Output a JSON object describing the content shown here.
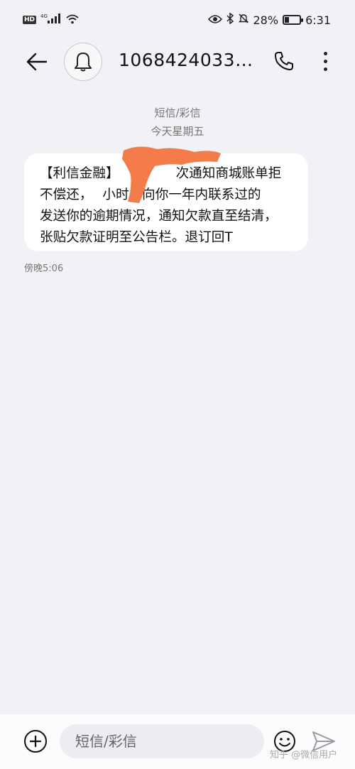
{
  "status_bar": {
    "hd_label": "HD",
    "network_label": "4G",
    "battery_percent": "28%",
    "battery_level": 0.28,
    "time": "6:31",
    "icons": [
      "signal-icon",
      "wifi-icon",
      "eye-icon",
      "bluetooth-icon",
      "mute-icon",
      "battery-icon"
    ]
  },
  "header": {
    "back_icon": "arrow-left-icon",
    "avatar_icon": "bell-icon",
    "contact_name": "10684240330...",
    "call_icon": "phone-icon",
    "more_icon": "more-vertical-icon"
  },
  "conversation": {
    "message_type": "短信/彩信",
    "date_label": "今天星期五",
    "messages": [
      {
        "lines": [
          "【利信金融】",
          "不偿还，",
          "发送你的逾期情况，通知欠款直至结清，",
          "张贴欠款证明至公告栏。退订回T"
        ],
        "line_tails": [
          "次通知商城账单拒",
          "小时后向你一年内联系过的"
        ],
        "time": "傍晚5:06",
        "redaction_color": "#f47c4a"
      }
    ]
  },
  "input_bar": {
    "placeholder": "短信/彩信",
    "add_icon": "plus-circle-icon",
    "emoji_icon": "emoji-icon",
    "send_icon": "send-icon"
  },
  "watermark": "知乎 @微信用户"
}
